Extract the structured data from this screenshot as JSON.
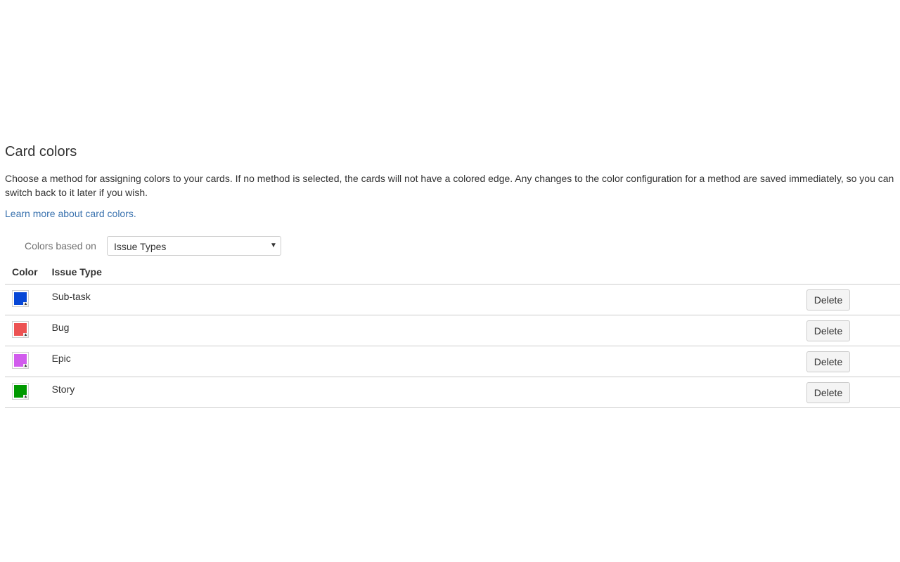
{
  "section": {
    "title": "Card colors",
    "description": "Choose a method for assigning colors to your cards. If no method is selected, the cards will not have a colored edge. Any changes to the color configuration for a method are saved immediately, so you can switch back to it later if you wish.",
    "learn_more_link": "Learn more about card colors."
  },
  "method": {
    "label": "Colors based on",
    "selected": "Issue Types"
  },
  "table": {
    "headers": {
      "color": "Color",
      "issue_type": "Issue Type"
    },
    "rows": [
      {
        "color": "#0747d6",
        "name": "Sub-task",
        "action": "Delete"
      },
      {
        "color": "#ec5252",
        "name": "Bug",
        "action": "Delete"
      },
      {
        "color": "#d15ced",
        "name": "Epic",
        "action": "Delete"
      },
      {
        "color": "#009900",
        "name": "Story",
        "action": "Delete"
      }
    ]
  },
  "icons": {
    "select_caret": "▼",
    "swatch_caret": "▲"
  }
}
